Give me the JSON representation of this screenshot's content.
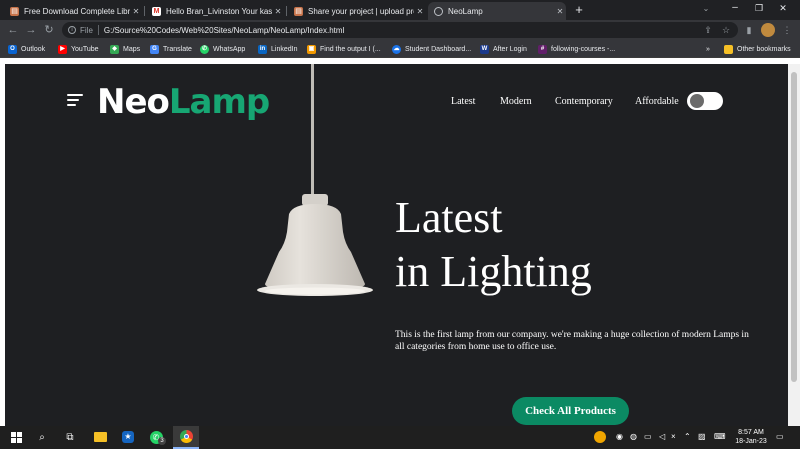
{
  "browser": {
    "tabs": [
      {
        "title": "Free Download Complete Library",
        "active": false
      },
      {
        "title": "Hello Bran_Livinston Your kaship",
        "active": false
      },
      {
        "title": "Share your project | upload proj",
        "active": false
      },
      {
        "title": "NeoLamp",
        "active": true
      }
    ],
    "new_tab_label": "+",
    "address": {
      "scheme_label": "File",
      "url": "G:/Source%20Codes/Web%20Sites/NeoLamp/NeoLamp/Index.html"
    },
    "bookmarks": [
      {
        "label": "Outlook",
        "icon": "outlook-icon",
        "color": "#0a64d0"
      },
      {
        "label": "YouTube",
        "icon": "youtube-icon",
        "color": "#ff0000"
      },
      {
        "label": "Maps",
        "icon": "maps-icon",
        "color": "#34a853"
      },
      {
        "label": "Translate",
        "icon": "translate-icon",
        "color": "#4285f4"
      },
      {
        "label": "WhatsApp",
        "icon": "whatsapp-icon",
        "color": "#25d366"
      },
      {
        "label": "LinkedIn",
        "icon": "linkedin-icon",
        "color": "#0a66c2"
      },
      {
        "label": "Find the output I (...",
        "icon": "site-icon",
        "color": "#f29900"
      },
      {
        "label": "Student Dashboard...",
        "icon": "cloud-icon",
        "color": "#1a73e8"
      },
      {
        "label": "After Login",
        "icon": "w-icon",
        "color": "#1b3a8c"
      },
      {
        "label": "following-courses -...",
        "icon": "slack-icon",
        "color": "#611f69"
      }
    ],
    "other_bookmarks": "Other bookmarks"
  },
  "site": {
    "logo": {
      "part1": "Neo",
      "part2": "Lamp"
    },
    "nav": [
      "Latest",
      "Modern",
      "Contemporary",
      "Affordable"
    ],
    "hero": {
      "line1": "Latest",
      "line2": "in Lighting",
      "description": "This is the first lamp from our company. we're making a huge collection of modern Lamps in all categories from home use to office use.",
      "cta": "Check All Products"
    },
    "colors": {
      "background": "#1e1f22",
      "accent": "#17a673",
      "button": "#0b8a63",
      "lamp_shade": "#d9d5cf"
    }
  },
  "taskbar": {
    "time": "8:57 AM",
    "date": "18-Jan-23",
    "whatsapp_badge": "3"
  }
}
